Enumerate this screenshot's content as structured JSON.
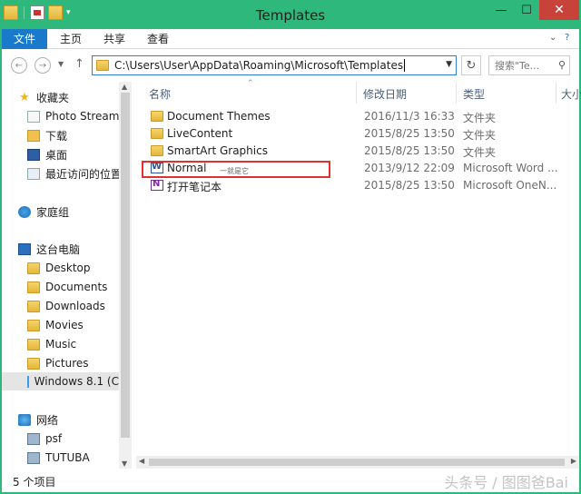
{
  "window": {
    "title": "Templates"
  },
  "ribbon": {
    "tabs": [
      "文件",
      "主页",
      "共享",
      "查看"
    ]
  },
  "address": {
    "path": "C:\\Users\\User\\AppData\\Roaming\\Microsoft\\Templates",
    "search_placeholder": "搜索\"Te..."
  },
  "nav": {
    "favorites": {
      "label": "收藏夹",
      "items": [
        "Photo Stream (I",
        "下载",
        "桌面",
        "最近访问的位置"
      ]
    },
    "homegroup": "家庭组",
    "thispc": {
      "label": "这台电脑",
      "items": [
        "Desktop",
        "Documents",
        "Downloads",
        "Movies",
        "Music",
        "Pictures",
        "Windows 8.1 (C"
      ]
    },
    "network": {
      "label": "网络",
      "items": [
        "psf",
        "TUTUBA"
      ]
    }
  },
  "columns": {
    "name": "名称",
    "date": "修改日期",
    "type": "类型",
    "size": "大小"
  },
  "files": [
    {
      "name": "Document Themes",
      "date": "2016/11/3 16:33",
      "type": "文件夹",
      "icon": "folder-icon"
    },
    {
      "name": "LiveContent",
      "date": "2015/8/25 13:50",
      "type": "文件夹",
      "icon": "folder-icon"
    },
    {
      "name": "SmartArt Graphics",
      "date": "2015/8/25 13:50",
      "type": "文件夹",
      "icon": "folder-icon"
    },
    {
      "name": "Normal",
      "date": "2013/9/12 22:09",
      "type": "Microsoft Word ...",
      "icon": "word-icon"
    },
    {
      "name": "打开笔记本",
      "date": "2015/8/25 13:50",
      "type": "Microsoft OneN...",
      "icon": "onenote-icon"
    }
  ],
  "annotation": "一就是它",
  "status": {
    "count": "5 个项目"
  },
  "watermark": "头条号 / 图图爸Bai"
}
